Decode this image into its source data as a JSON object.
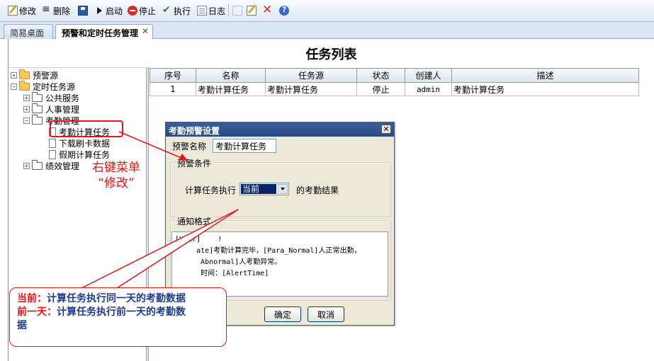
{
  "toolbar": {
    "items": [
      {
        "label": "修改",
        "icon": "edit-icon"
      },
      {
        "label": "删除",
        "icon": "delete-icon"
      },
      {
        "label": "",
        "icon": "save-icon"
      },
      {
        "label": "启动",
        "icon": "start-icon"
      },
      {
        "label": "停止",
        "icon": "stop-icon"
      },
      {
        "label": "执行",
        "icon": "execute-icon"
      },
      {
        "label": "日志",
        "icon": "log-icon"
      },
      {
        "label": "",
        "icon": "help-icon"
      }
    ]
  },
  "tabs": [
    {
      "label": "简易桌面"
    },
    {
      "label": "预警和定时任务管理"
    }
  ],
  "page_title": "任务列表",
  "tree": {
    "nodes": [
      {
        "label": "预警源"
      },
      {
        "label": "定时任务源"
      },
      {
        "label": "公共服务"
      },
      {
        "label": "人事管理"
      },
      {
        "label": "考勤管理"
      },
      {
        "label": "考勤计算任务"
      },
      {
        "label": "下载刷卡数据"
      },
      {
        "label": "假期计算任务"
      },
      {
        "label": "绩效管理"
      }
    ]
  },
  "grid": {
    "headers": [
      "序号",
      "名称",
      "任务源",
      "状态",
      "创建人",
      "描述"
    ],
    "rows": [
      [
        "1",
        "考勤计算任务",
        "考勤计算任务",
        "停止",
        "admin",
        "考勤计算任务"
      ]
    ]
  },
  "dialog": {
    "title": "考勤预警设置",
    "name_label": "预警名称",
    "name_value": "考勤计算任务",
    "condition_legend": "预警条件",
    "condition_prefix": "计算任务执行",
    "condition_select": "当前",
    "condition_suffix": "的考勤结果",
    "format_legend": "通知格式",
    "format_lines": [
      "[User]    !",
      "",
      "     ate]考勤计算完毕，[Para_Normal]人正常出勤，",
      "      Abnormal]人考勤异常。",
      "      时间：[AlertTime]"
    ],
    "ok_label": "确定",
    "cancel_label": "取消"
  },
  "annotations": {
    "right_click_line1": "右键菜单",
    "right_click_line2": "“修改”",
    "callout": [
      {
        "key": "当前：",
        "text": "计算任务执行同一天的考勤数据"
      },
      {
        "key": "前一天：",
        "text": "计算任务执行前一天的考勤数"
      },
      {
        "key": "",
        "text": "据"
      }
    ]
  },
  "colors": {
    "annotation_red": "#e5141a",
    "callout_blue": "#1f3d8f",
    "titlebar": "#2a4a86"
  }
}
